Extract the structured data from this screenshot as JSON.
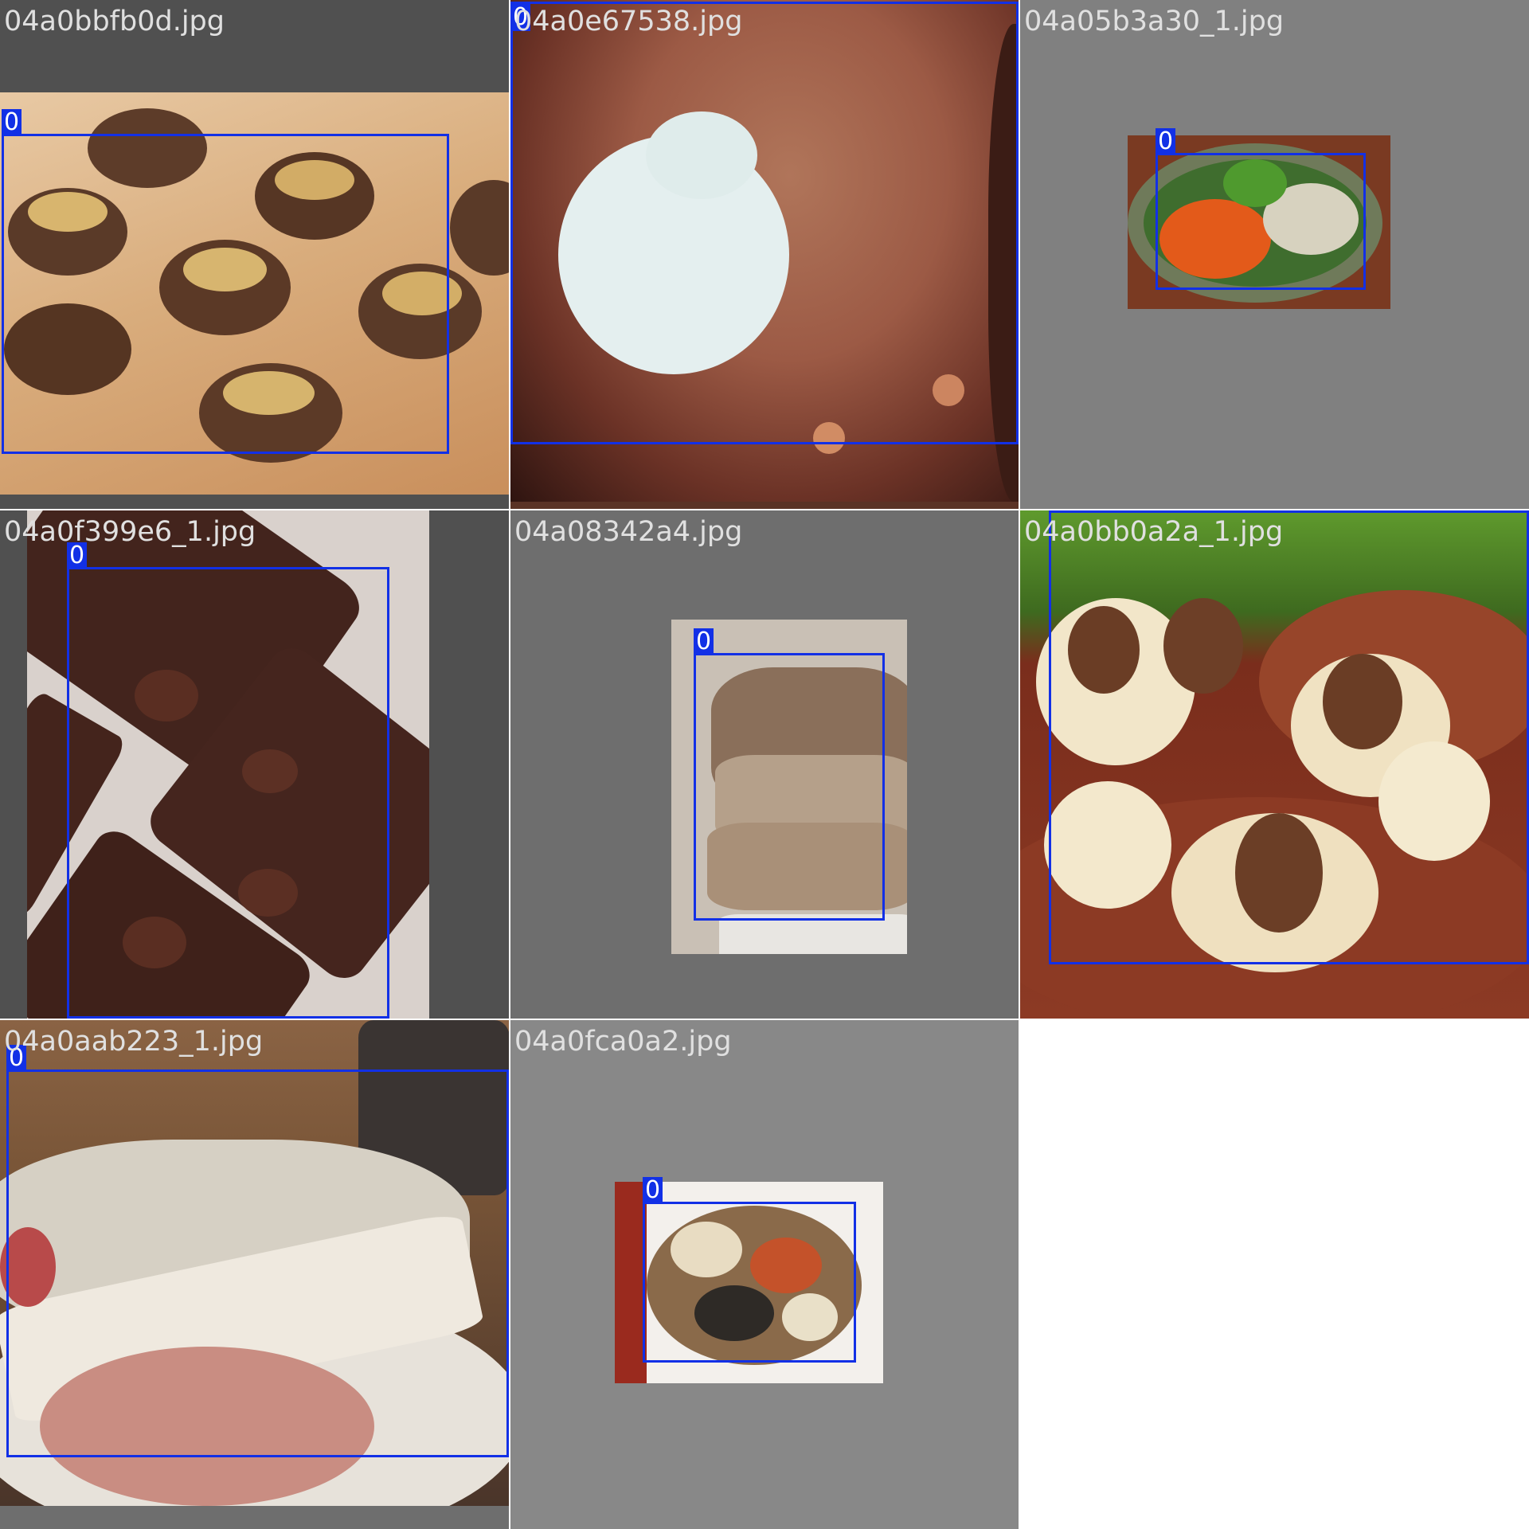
{
  "grid": {
    "tiles": [
      {
        "filename": "04a0bbfb0d.jpg",
        "subject": "stuffed mushrooms",
        "boxes": [
          {
            "label": "0"
          }
        ]
      },
      {
        "filename": "04a0e67538.jpg",
        "subject": "cocoa and powdered sugar",
        "boxes": [
          {
            "label": "0"
          }
        ]
      },
      {
        "filename": "04a05b3a30_1.jpg",
        "subject": "salad bowl",
        "boxes": [
          {
            "label": "0"
          }
        ]
      },
      {
        "filename": "04a0f399e6_1.jpg",
        "subject": "brownies",
        "boxes": [
          {
            "label": "0"
          }
        ]
      },
      {
        "filename": "04a08342a4.jpg",
        "subject": "banana bread",
        "boxes": [
          {
            "label": "0"
          }
        ]
      },
      {
        "filename": "04a0bb0a2a_1.jpg",
        "subject": "popcorn with teddy grahams",
        "boxes": [
          {
            "label": "0"
          }
        ]
      },
      {
        "filename": "04a0aab223_1.jpg",
        "subject": "bread and cheese",
        "boxes": [
          {
            "label": "0"
          }
        ]
      },
      {
        "filename": "04a0fca0a2.jpg",
        "subject": "grain mix",
        "boxes": [
          {
            "label": "0"
          }
        ]
      }
    ]
  },
  "colors": {
    "box": "#1230e6",
    "label_text": "#ffffff",
    "filename_text": "#e0e0e0",
    "grid_line": "#ffffff"
  }
}
